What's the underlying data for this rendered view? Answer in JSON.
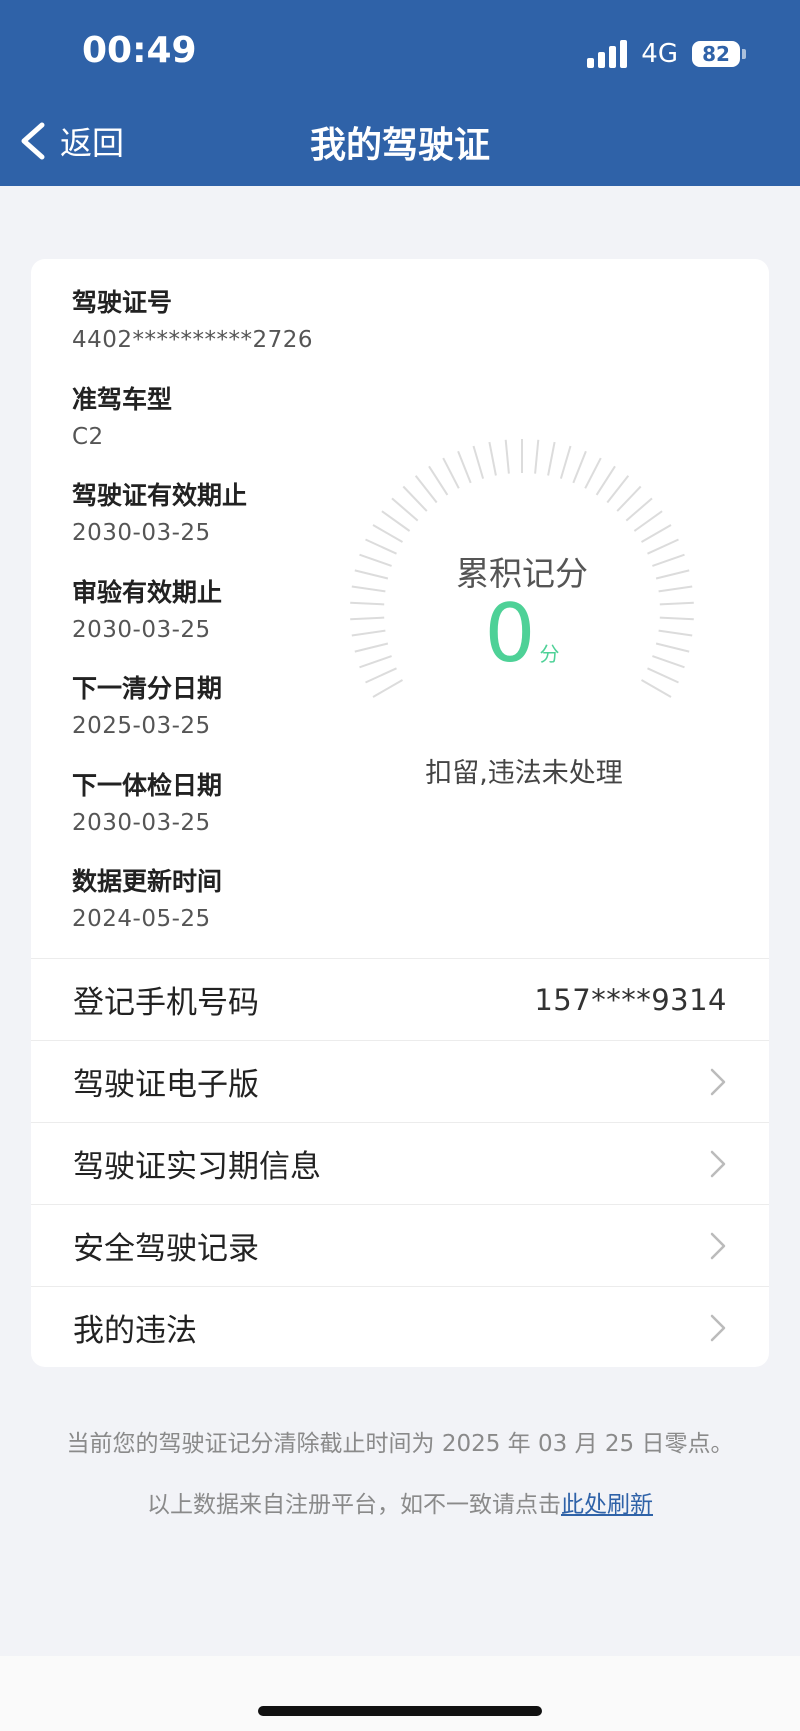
{
  "status_bar": {
    "time": "00:49",
    "network": "4G",
    "battery": "82"
  },
  "nav": {
    "back_label": "返回",
    "title": "我的驾驶证"
  },
  "info": [
    {
      "label": "驾驶证号",
      "value": "4402**********2726"
    },
    {
      "label": "准驾车型",
      "value": "C2"
    },
    {
      "label": "驾驶证有效期止",
      "value": "2030-03-25"
    },
    {
      "label": "审验有效期止",
      "value": "2030-03-25"
    },
    {
      "label": "下一清分日期",
      "value": "2025-03-25"
    },
    {
      "label": "下一体检日期",
      "value": "2030-03-25"
    },
    {
      "label": "数据更新时间",
      "value": "2024-05-25"
    }
  ],
  "gauge": {
    "label": "累积记分",
    "score": "0",
    "unit": "分",
    "status": "扣留,违法未处理",
    "score_color": "#4ed197"
  },
  "rows": [
    {
      "label": "登记手机号码",
      "value": "157****9314"
    },
    {
      "label": "驾驶证电子版"
    },
    {
      "label": "驾驶证实习期信息"
    },
    {
      "label": "安全驾驶记录"
    },
    {
      "label": "我的违法"
    }
  ],
  "notes": {
    "line1": "当前您的驾驶证记分清除截止时间为 2025 年 03 月 25 日零点。",
    "line2_prefix": "以上数据来自注册平台，如不一致请点击",
    "line2_link": "此处刷新"
  },
  "colors": {
    "header_bg": "#2f62a8",
    "page_bg": "#f2f3f7"
  }
}
